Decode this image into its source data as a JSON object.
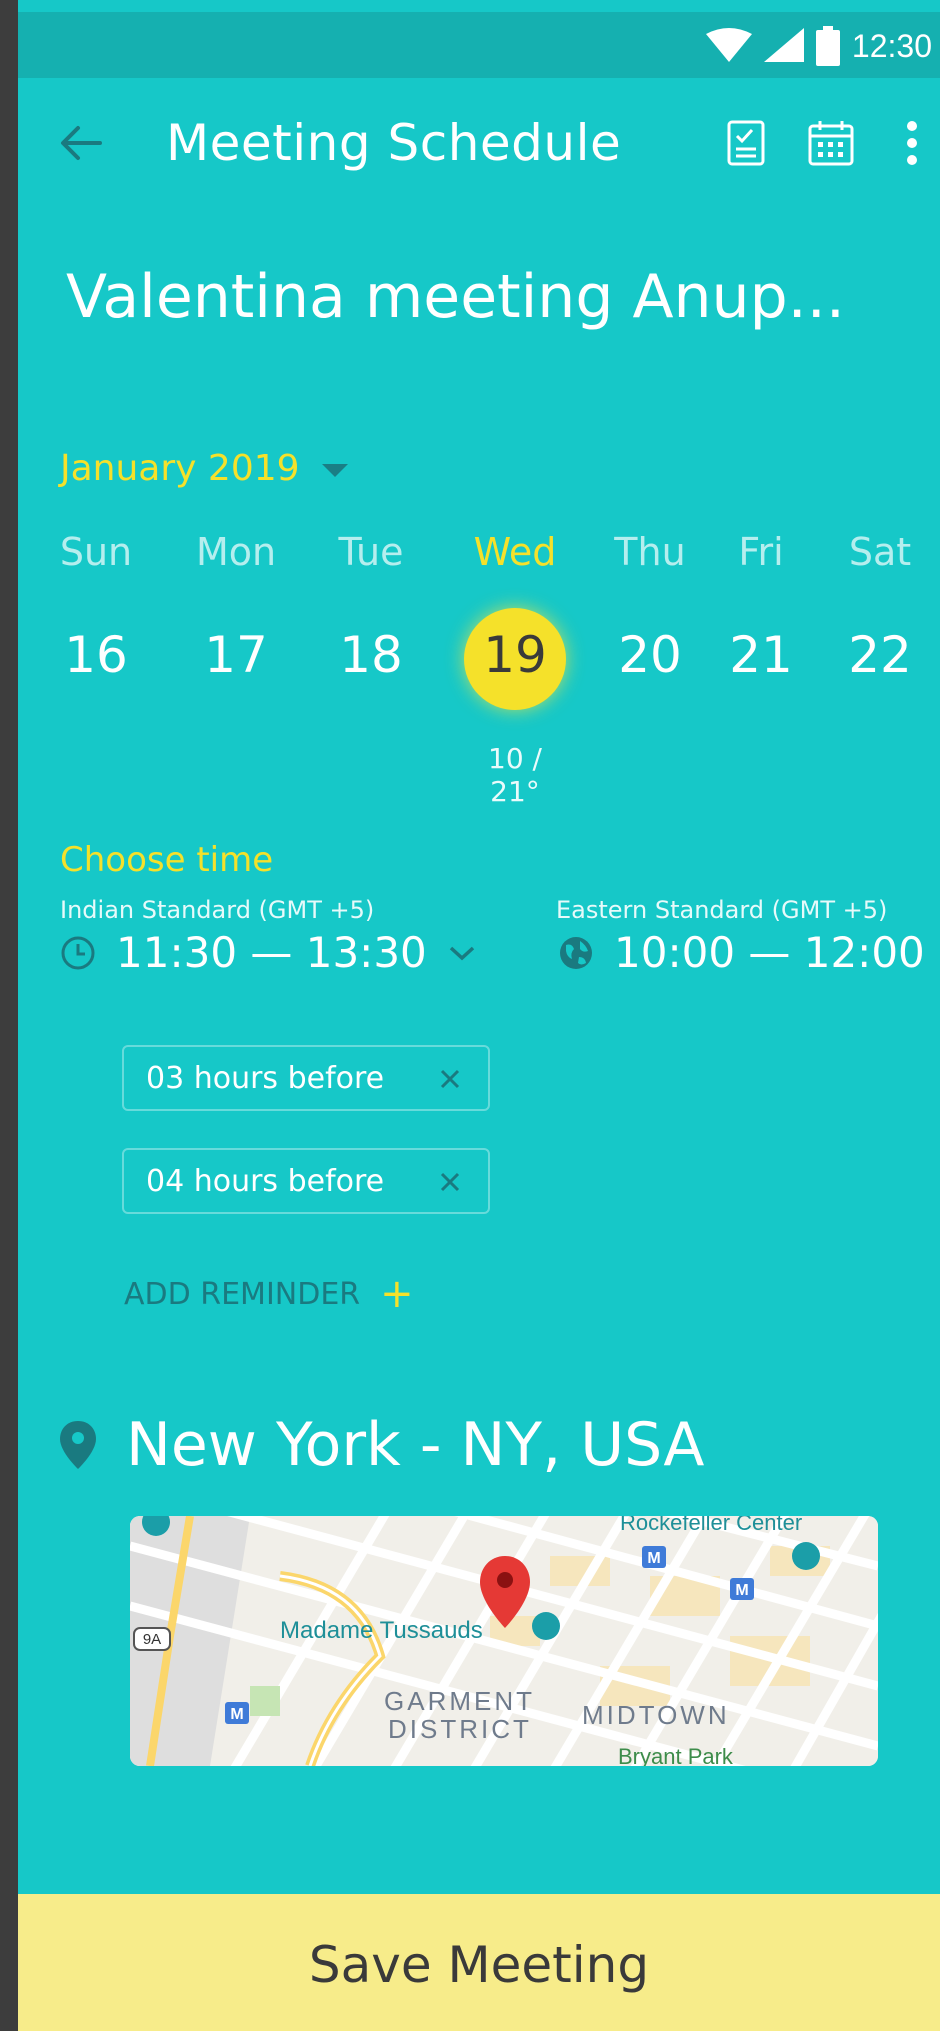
{
  "status_bar": {
    "time": "12:30",
    "icons": [
      "wifi-icon",
      "signal-icon",
      "battery-icon"
    ]
  },
  "app_bar": {
    "title": "Meeting Schedule",
    "icons": [
      "back-arrow-icon",
      "checklist-icon",
      "calendar-icon",
      "more-vert-icon"
    ]
  },
  "meeting": {
    "title": "Valentina meeting Anup..."
  },
  "calendar": {
    "month_label": "January 2019",
    "weekdays": [
      "Sun",
      "Mon",
      "Tue",
      "Wed",
      "Thu",
      "Fri",
      "Sat"
    ],
    "days": [
      "16",
      "17",
      "18",
      "19",
      "20",
      "21",
      "22"
    ],
    "selected_day": "19",
    "temperature": "10 / 21°"
  },
  "time": {
    "label": "Choose time",
    "local": {
      "zone": "Indian Standard (GMT +5)",
      "range": "11:30 — 13:30"
    },
    "remote": {
      "zone": "Eastern Standard (GMT +5)",
      "range": "10:00 — 12:00"
    }
  },
  "reminders": {
    "items": [
      {
        "label": "03 hours before"
      },
      {
        "label": "04 hours before"
      }
    ],
    "add_label": "ADD REMINDER",
    "add_icon": "+"
  },
  "location": {
    "label": "New York - NY, USA",
    "map_labels": {
      "rockefeller": "Rockefeller Center",
      "tussauds": "Madame Tussauds",
      "garment": "GARMENT",
      "district": "DISTRICT",
      "midtown": "MIDTOWN",
      "bryant": "Bryant Park",
      "route": "9A",
      "metro": "M"
    }
  },
  "footer": {
    "save_label": "Save Meeting"
  },
  "colors": {
    "background": "#16c8c8",
    "status_bar": "#15b0b0",
    "accent_yellow": "#f5e12a",
    "save_bar": "#f7ec8a",
    "dark_teal": "#1a7a80"
  }
}
